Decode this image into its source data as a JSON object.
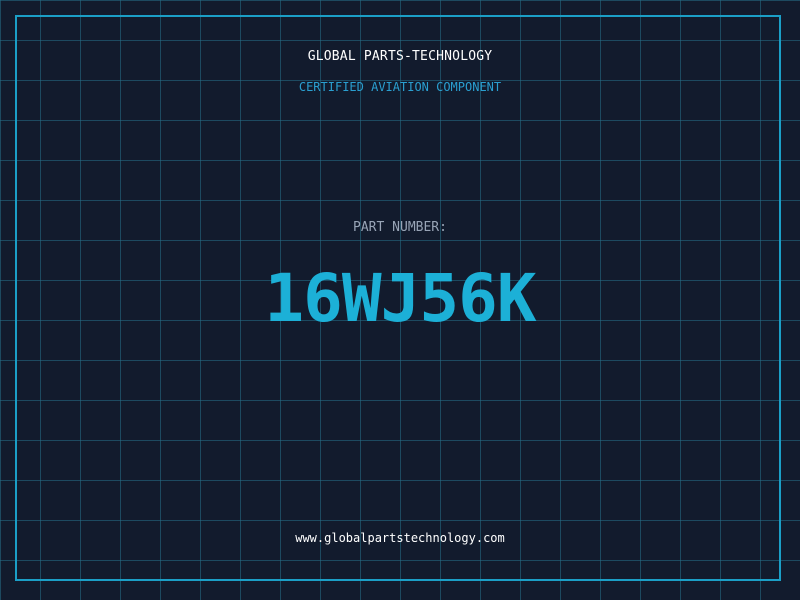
{
  "brand": {
    "name": "GLOBAL PARTS-TECHNOLOGY",
    "tagline": "CERTIFIED AVIATION COMPONENT"
  },
  "part": {
    "label": "PART NUMBER:",
    "number": "16WJ56K"
  },
  "footer": {
    "website": "www.globalpartstechnology.com"
  },
  "colors": {
    "background": "#121b2d",
    "grid": "#26708a",
    "frame": "#1b9fc7",
    "accent": "#1cb0d7"
  }
}
